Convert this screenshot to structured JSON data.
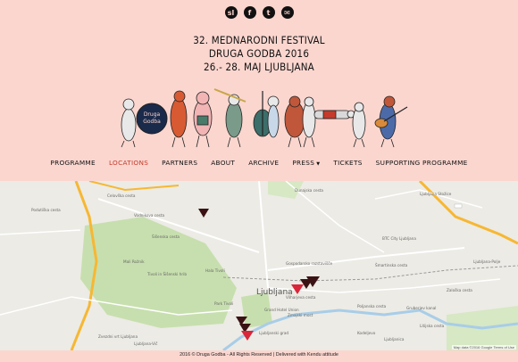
{
  "social": [
    {
      "name": "sl",
      "glyph": "sl"
    },
    {
      "name": "facebook",
      "glyph": "f"
    },
    {
      "name": "twitter",
      "glyph": "t"
    },
    {
      "name": "email",
      "glyph": "✉"
    }
  ],
  "festival": {
    "line1": "32. Mednarodni festival",
    "line2": "Druga godba 2016",
    "line3": "26.- 28. maj Ljubljana"
  },
  "illustration": {
    "badge_line1": "Druga",
    "badge_line2": "Godba"
  },
  "nav": {
    "items": [
      "Programme",
      "Locations",
      "Partners",
      "About",
      "Archive",
      "Press",
      "Tickets",
      "Supporting programme"
    ],
    "active": "Locations"
  },
  "map": {
    "city": "Ljubljana",
    "labels": [
      "Celovška cesta",
      "Vodnikova cesta",
      "Podutiška cesta",
      "Šišenska cesta",
      "Mali Rožnik",
      "Hala Tivoli",
      "Tivoli in Šišenski hrib",
      "Park Tivoli",
      "Zvezdni vrt Ljubljana",
      "Gospodarsko razstavišče",
      "Vilharjeva cesta",
      "Grand Hotel Union",
      "Zmajski most",
      "BTC City Ljubljana",
      "Šmartinska cesta",
      "Ljubljanski grad",
      "Poljanska cesta",
      "Gruberjev kanal",
      "Ljubljana-Vič",
      "Dunajska cesta",
      "Litijska cesta",
      "Kodeljevo",
      "Ljubljanica",
      "Zaloška cesta",
      "Ljubljana Stožice",
      "Ljubljana-Polje"
    ],
    "attribution_data": "Map data ©2016 Google",
    "attribution_terms": "Terms of Use"
  },
  "footer": "2016 © Druga Godba - All Rights Reserved | Delivered with Kendu attitude",
  "colors": {
    "background": "#fbd6cf",
    "active_nav": "#c43b2b",
    "marker": "#d9263b",
    "marker_dark": "#3b1214"
  }
}
